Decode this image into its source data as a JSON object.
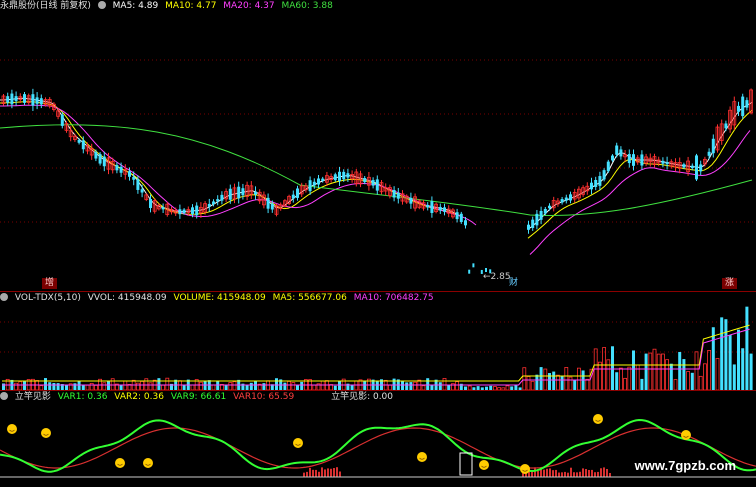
{
  "price_header": {
    "title": "永鼎股份(日线 前复权)",
    "ma5": "MA5: 4.89",
    "ma10": "MA10: 4.77",
    "ma20": "MA20: 4.37",
    "ma60": "MA60: 3.88"
  },
  "price_markers": {
    "low_label": "←2.85",
    "zeng_badge": "增",
    "cai_badge": "财",
    "zhang_badge": "涨"
  },
  "vol_header": {
    "name": "VOL-TDX(5,10)",
    "vvol": "VVOL: 415948.09",
    "volume": "VOLUME: 415948.09",
    "ma5": "MA5: 556677.06",
    "ma10": "MA10: 706482.75"
  },
  "ind_header": {
    "name": "立竿见影",
    "var1": "VAR1: 0.36",
    "var2": "VAR2: 0.36",
    "var9": "VAR9: 66.61",
    "var10": "VAR10: 65.59",
    "extra": "立竿见影: 0.00"
  },
  "watermark": "www.7gpzb.com",
  "colors": {
    "up": "#ff3030",
    "down": "#44e0ff",
    "ma5": "#ffffff",
    "ma10": "#ffff00",
    "ma20": "#ff40ff",
    "ma60": "#40e040",
    "indicator_green": "#33ff33",
    "indicator_red": "#d83030"
  }
}
